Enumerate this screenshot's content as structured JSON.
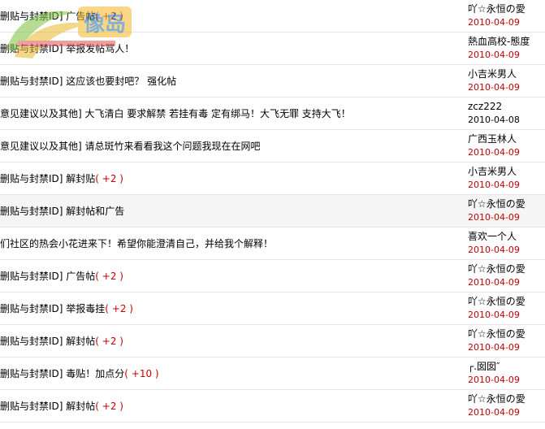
{
  "watermark": {
    "text": "像岛"
  },
  "threads": [
    {
      "title": "删贴与封禁ID] 广告帖",
      "points": "( +2 )",
      "author": "吖☆永恒の愛",
      "date": "2010-04-09",
      "date_color": "red"
    },
    {
      "title": "删贴与封禁ID] 举报发帖骂人！",
      "points": "",
      "author": "熱血高校-態度",
      "date": "2010-04-09",
      "date_color": "red"
    },
    {
      "title": "删贴与封禁ID] 这应该也要封吧？ 强化帖",
      "points": "",
      "author": "小吉米男人",
      "date": "2010-04-09",
      "date_color": "red"
    },
    {
      "title": "意见建议以及其他] 大飞清白 要求解禁 若挂有毒 定有绑马！大飞无罪 支持大飞！",
      "points": "",
      "author": "zcz222",
      "date": "2010-04-08",
      "date_color": "black"
    },
    {
      "title": "意见建议以及其他] 请总斑竹来看看我这个问题我现在在网吧",
      "points": "",
      "author": "广西玉林人",
      "date": "2010-04-09",
      "date_color": "red"
    },
    {
      "title": "删贴与封禁ID] 解封贴",
      "points": "( +2 )",
      "author": "小吉米男人",
      "date": "2010-04-09",
      "date_color": "red"
    },
    {
      "title": "删贴与封禁ID] 解封帖和广告",
      "points": "",
      "author": "吖☆永恒の愛",
      "date": "2010-04-09",
      "date_color": "red"
    },
    {
      "title": "们社区的热会小花进来下！希望你能澄清自己，并给我个解释！",
      "points": "",
      "author": "喜欢一个人",
      "date": "2010-04-09",
      "date_color": "red"
    },
    {
      "title": "删贴与封禁ID] 广告帖",
      "points": "( +2 )",
      "author": "吖☆永恒の愛",
      "date": "2010-04-09",
      "date_color": "red"
    },
    {
      "title": "删贴与封禁ID] 举报毒挂",
      "points": "( +2 )",
      "author": "吖☆永恒の愛",
      "date": "2010-04-09",
      "date_color": "red"
    },
    {
      "title": "删贴与封禁ID] 解封帖",
      "points": "( +2 )",
      "author": "吖☆永恒の愛",
      "date": "2010-04-09",
      "date_color": "red"
    },
    {
      "title": "删贴与封禁ID] 毒贴！加点分",
      "points": "( +10 )",
      "author": "┌.囡囡″",
      "date": "2010-04-09",
      "date_color": "red"
    },
    {
      "title": "删贴与封禁ID] 解封帖",
      "points": "( +2 )",
      "author": "吖☆永恒の愛",
      "date": "2010-04-09",
      "date_color": "red"
    }
  ],
  "highlight_row": 6
}
